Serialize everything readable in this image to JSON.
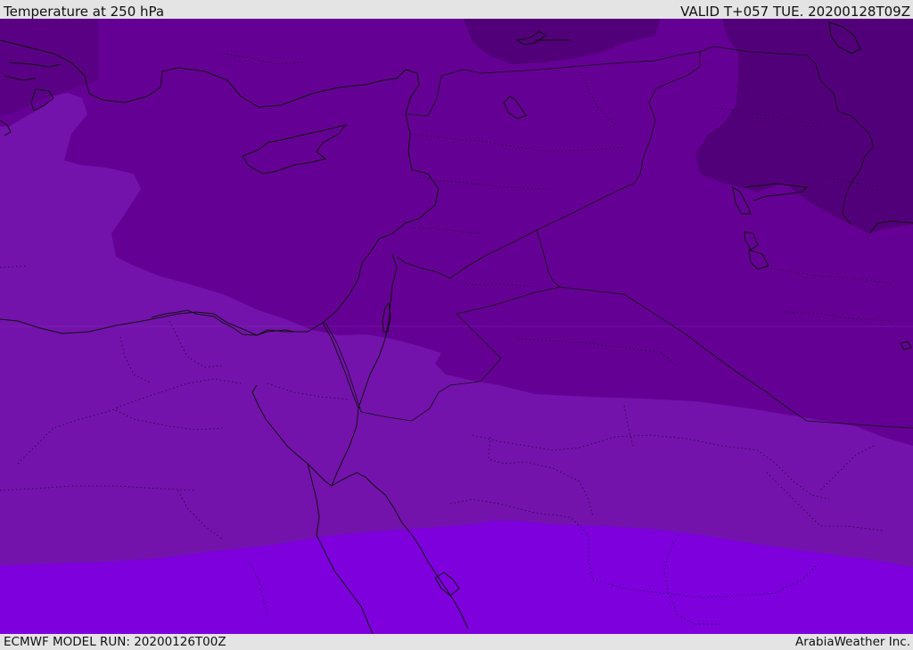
{
  "header": {
    "title": "Temperature at 250 hPa",
    "valid_time": "VALID T+057 TUE. 20200128T09Z"
  },
  "footer": {
    "model_run": "ECMWF MODEL RUN: 20200126T00Z",
    "provider": "ArabiaWeather Inc."
  },
  "palette": {
    "darkest": "#520079",
    "dark": "#650094",
    "medium": "#7313ab",
    "bright": "#7d00dd",
    "coast": "#111111"
  }
}
